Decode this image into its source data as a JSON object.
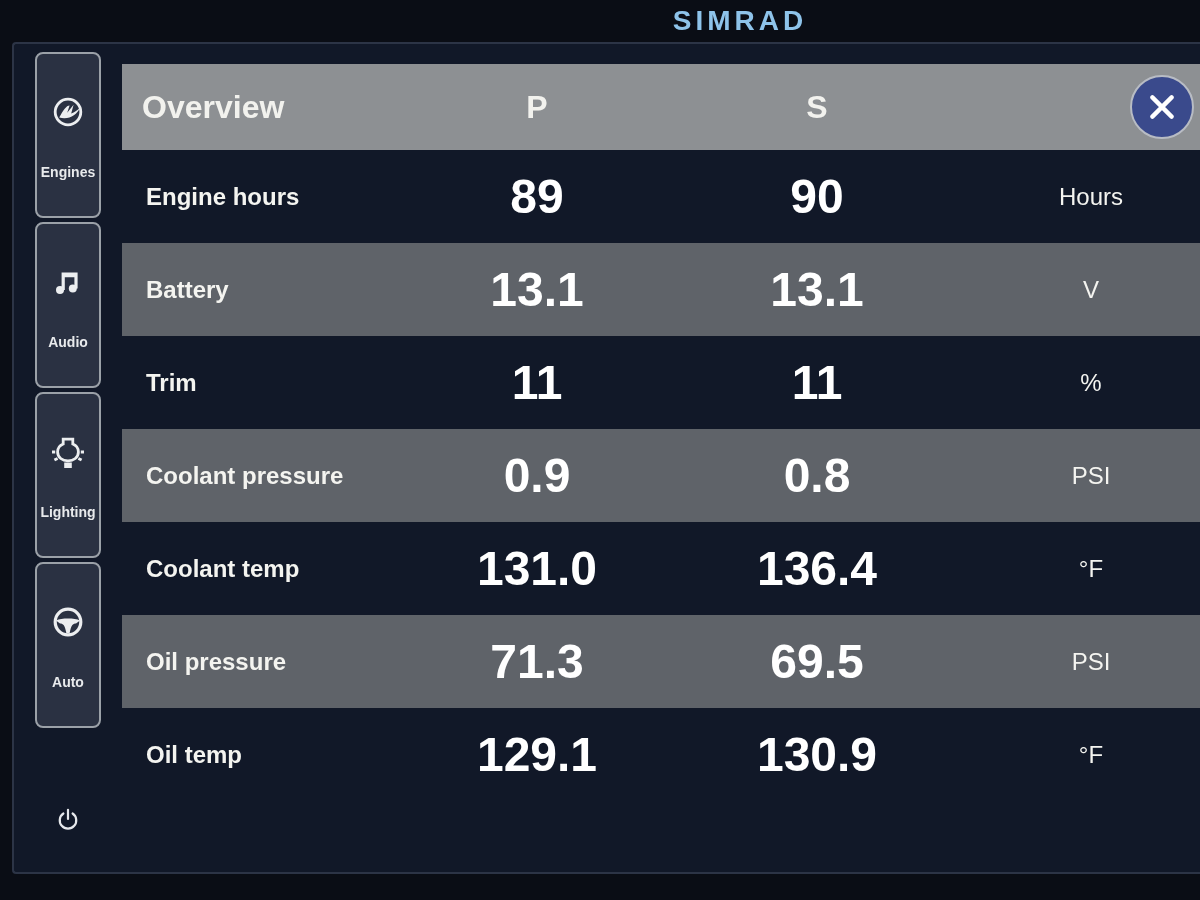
{
  "bezel": {
    "brand": "SIMRAD"
  },
  "sidebar": {
    "tabs": [
      {
        "label": "Engines"
      },
      {
        "label": "Audio"
      },
      {
        "label": "Lighting"
      },
      {
        "label": "Auto"
      }
    ]
  },
  "table": {
    "title": "Overview",
    "columns": [
      "P",
      "S"
    ],
    "rows": [
      {
        "name": "Engine hours",
        "p": "89",
        "s": "90",
        "unit": "Hours"
      },
      {
        "name": "Battery",
        "p": "13.1",
        "s": "13.1",
        "unit": "V"
      },
      {
        "name": "Trim",
        "p": "11",
        "s": "11",
        "unit": "%"
      },
      {
        "name": "Coolant pressure",
        "p": "0.9",
        "s": "0.8",
        "unit": "PSI"
      },
      {
        "name": "Coolant temp",
        "p": "131.0",
        "s": "136.4",
        "unit": "°F"
      },
      {
        "name": "Oil pressure",
        "p": "71.3",
        "s": "69.5",
        "unit": "PSI"
      },
      {
        "name": "Oil temp",
        "p": "129.1",
        "s": "130.9",
        "unit": "°F"
      }
    ]
  }
}
